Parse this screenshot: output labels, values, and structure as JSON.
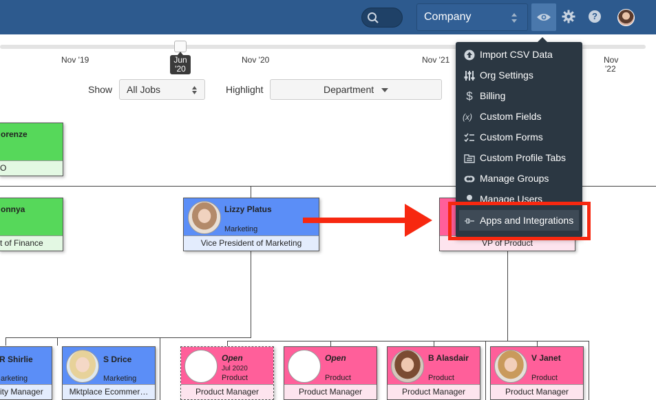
{
  "topbar": {
    "company_select": "Company",
    "icons": [
      "search-icon",
      "eye-icon",
      "gear-icon",
      "help-icon",
      "user-avatar"
    ]
  },
  "timeline": {
    "ticks": [
      "Nov '19",
      "Nov '20",
      "Nov '21",
      "Nov",
      "'22"
    ],
    "selected_date_line1": "Jun",
    "selected_date_line2": "'20"
  },
  "filters": {
    "show_label": "Show",
    "show_value": "All Jobs",
    "highlight_label": "Highlight",
    "highlight_value": "Department"
  },
  "cards": {
    "c1": {
      "name": "orenze",
      "title": "O"
    },
    "c2": {
      "name": "onnya",
      "title": "t of Finance"
    },
    "lizzy": {
      "name": "Lizzy Platus",
      "dept": "Marketing",
      "title": "Vice President of Marketing"
    },
    "vp_product": {
      "title": "VP of Product"
    },
    "shirlie": {
      "name": "R Shirlie",
      "dept": "arketing",
      "title": "ity Manager"
    },
    "sdrice": {
      "name": "S Drice",
      "dept": "Marketing",
      "title": "Mktplace Ecommer…"
    },
    "open1": {
      "name": "Open",
      "date": "Jul 2020",
      "dept": "Product",
      "title": "Product Manager"
    },
    "open2": {
      "name": "Open",
      "dept": "Product",
      "title": "Product Manager"
    },
    "alasdair": {
      "name": "B Alasdair",
      "dept": "Product",
      "title": "Product Manager"
    },
    "janet": {
      "name": "V Janet",
      "dept": "Product",
      "title": "Product Manager"
    }
  },
  "menu": {
    "items": [
      {
        "label": "Import CSV Data",
        "icon": "upload-icon"
      },
      {
        "label": "Org Settings",
        "icon": "sliders-icon"
      },
      {
        "label": "Billing",
        "icon": "dollar-icon"
      },
      {
        "label": "Custom Fields",
        "icon": "variable-icon"
      },
      {
        "label": "Custom Forms",
        "icon": "checklist-icon"
      },
      {
        "label": "Custom Profile Tabs",
        "icon": "tabs-icon"
      },
      {
        "label": "Manage Groups",
        "icon": "groups-icon"
      },
      {
        "label": "Manage Users",
        "icon": "user-icon"
      },
      {
        "label": "Apps and Integrations",
        "icon": "plug-icon"
      }
    ]
  },
  "colors": {
    "topbar": "#2d5a8e",
    "green_card": "#56d85a",
    "blue_card": "#5b8ef7",
    "pink_card": "#ff5f9a",
    "menu_bg": "#2b3742",
    "annotation": "#f72810"
  }
}
